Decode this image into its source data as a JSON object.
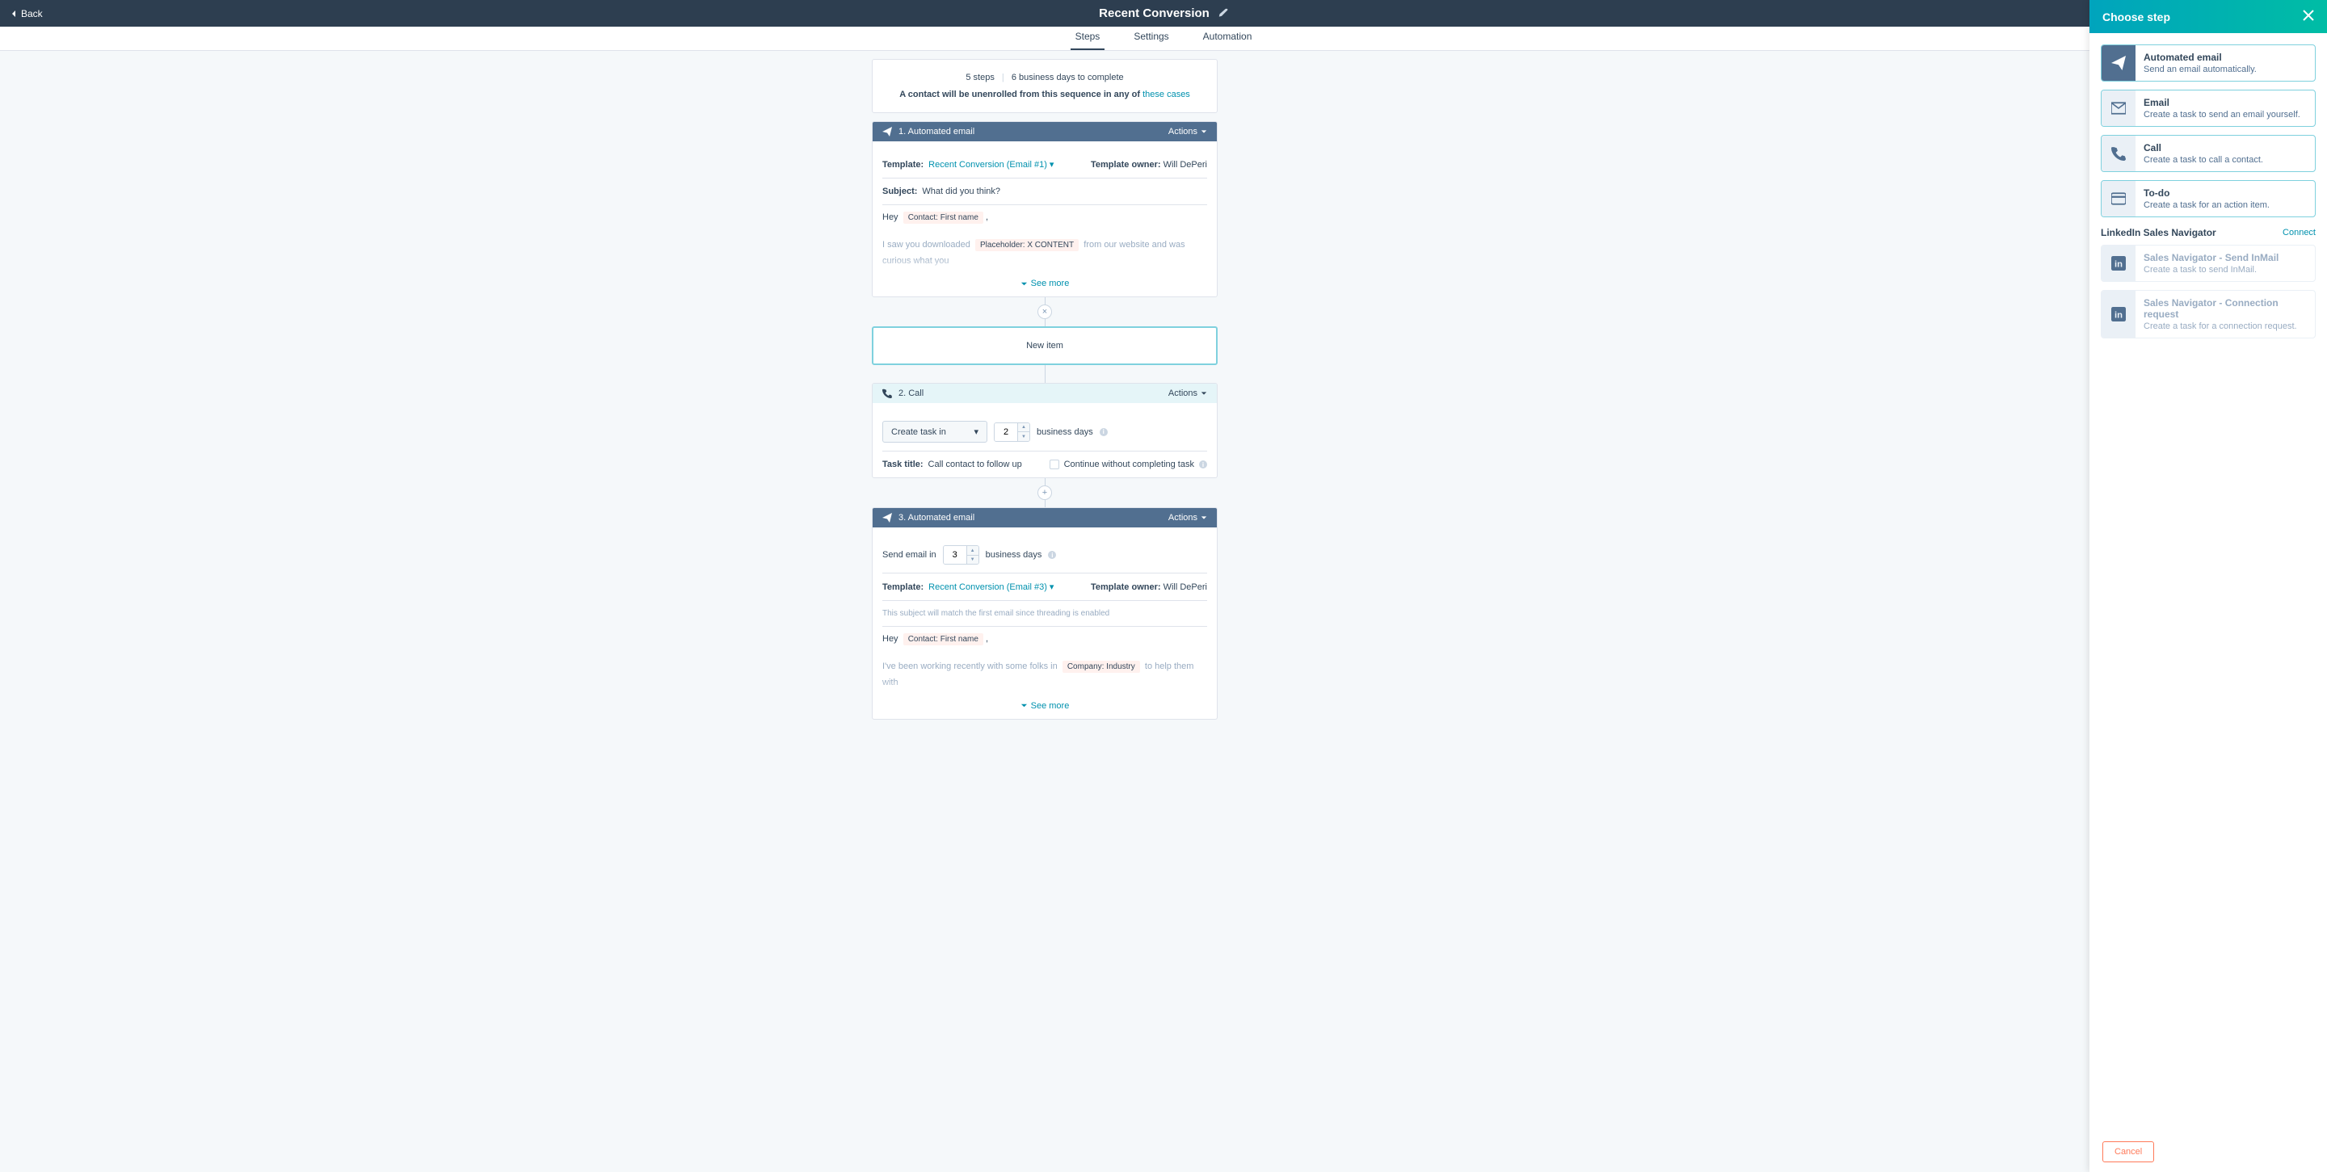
{
  "header": {
    "back": "Back",
    "title": "Recent Conversion"
  },
  "tabs": {
    "steps": "Steps",
    "settings": "Settings",
    "automation": "Automation"
  },
  "summary": {
    "steps": "5 steps",
    "days": "6 business days to complete",
    "unenroll_prefix": "A contact will be unenrolled from this sequence in any of ",
    "unenroll_link": "these cases"
  },
  "step1": {
    "title": "1. Automated email",
    "actions": "Actions",
    "template_lbl": "Template:",
    "template_link": "Recent Conversion (Email #1)",
    "owner_lbl": "Template owner:",
    "owner": "Will DePeri",
    "subject_lbl": "Subject:",
    "subject": "What did you think?",
    "greeting": "Hey",
    "token1": "Contact: First name",
    "comma": ",",
    "line1": "I saw you downloaded ",
    "token2": "Placeholder: X CONTENT",
    "line1b": " from our website and was curious what you",
    "see_more": "See more"
  },
  "new_item": {
    "label": "New item",
    "close": "×",
    "plus": "+"
  },
  "step2": {
    "title": "2. Call",
    "actions": "Actions",
    "create_task": "Create task in",
    "days_val": "2",
    "days_lbl": "business days",
    "task_lbl": "Task title:",
    "task_val": "Call contact to follow up",
    "continue": "Continue without completing task"
  },
  "step3": {
    "title": "3. Automated email",
    "actions": "Actions",
    "send_lbl": "Send email in",
    "days_val": "3",
    "days_lbl": "business days",
    "template_lbl": "Template:",
    "template_link": "Recent Conversion (Email #3)",
    "owner_lbl": "Template owner:",
    "owner": "Will DePeri",
    "threading": "This subject will match the first email since threading is enabled",
    "greeting": "Hey",
    "token1": "Contact: First name",
    "comma": ",",
    "line1": "I've been working recently with some folks in ",
    "token2": "Company: Industry",
    "line1b": " to help them with",
    "see_more": "See more"
  },
  "panel": {
    "title": "Choose step",
    "opts": [
      {
        "title": "Automated email",
        "desc": "Send an email automatically."
      },
      {
        "title": "Email",
        "desc": "Create a task to send an email yourself."
      },
      {
        "title": "Call",
        "desc": "Create a task to call a contact."
      },
      {
        "title": "To-do",
        "desc": "Create a task for an action item."
      }
    ],
    "section": "LinkedIn Sales Navigator",
    "connect": "Connect",
    "disabled_opts": [
      {
        "title": "Sales Navigator - Send InMail",
        "desc": "Create a task to send InMail."
      },
      {
        "title": "Sales Navigator - Connection request",
        "desc": "Create a task for a connection request."
      }
    ],
    "cancel": "Cancel"
  }
}
